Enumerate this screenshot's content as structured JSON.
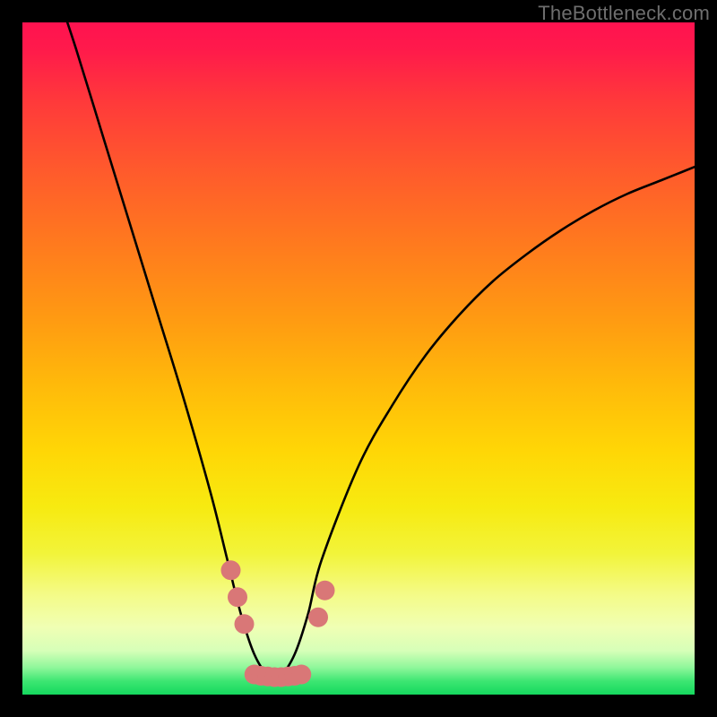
{
  "watermark": "TheBottleneck.com",
  "chart_data": {
    "type": "line",
    "title": "",
    "xlabel": "",
    "ylabel": "",
    "xlim": [
      0,
      1
    ],
    "ylim": [
      0,
      1
    ],
    "series": [
      {
        "name": "curve",
        "x": [
          0.05,
          0.08,
          0.12,
          0.16,
          0.2,
          0.24,
          0.28,
          0.305,
          0.325,
          0.345,
          0.365,
          0.385,
          0.405,
          0.425,
          0.445,
          0.5,
          0.55,
          0.6,
          0.65,
          0.7,
          0.75,
          0.8,
          0.85,
          0.9,
          0.95,
          1.0
        ],
        "y": [
          1.05,
          0.96,
          0.83,
          0.7,
          0.57,
          0.44,
          0.3,
          0.2,
          0.12,
          0.06,
          0.03,
          0.03,
          0.06,
          0.12,
          0.2,
          0.34,
          0.43,
          0.505,
          0.565,
          0.615,
          0.655,
          0.69,
          0.72,
          0.745,
          0.765,
          0.785
        ]
      }
    ],
    "markers": [
      {
        "x": 0.31,
        "y": 0.185
      },
      {
        "x": 0.32,
        "y": 0.145
      },
      {
        "x": 0.33,
        "y": 0.105
      },
      {
        "x": 0.345,
        "y": 0.03
      },
      {
        "x": 0.355,
        "y": 0.028
      },
      {
        "x": 0.365,
        "y": 0.027
      },
      {
        "x": 0.375,
        "y": 0.026
      },
      {
        "x": 0.385,
        "y": 0.026
      },
      {
        "x": 0.395,
        "y": 0.027
      },
      {
        "x": 0.405,
        "y": 0.028
      },
      {
        "x": 0.415,
        "y": 0.03
      },
      {
        "x": 0.44,
        "y": 0.115
      },
      {
        "x": 0.45,
        "y": 0.155
      }
    ],
    "gradient_stops": [
      {
        "offset": 0.0,
        "color": "#ff1250"
      },
      {
        "offset": 0.04,
        "color": "#ff1a4b"
      },
      {
        "offset": 0.12,
        "color": "#ff3a3a"
      },
      {
        "offset": 0.22,
        "color": "#ff5a2c"
      },
      {
        "offset": 0.33,
        "color": "#ff7a1e"
      },
      {
        "offset": 0.44,
        "color": "#ff9a12"
      },
      {
        "offset": 0.54,
        "color": "#ffba0a"
      },
      {
        "offset": 0.64,
        "color": "#ffd706"
      },
      {
        "offset": 0.72,
        "color": "#f7ea10"
      },
      {
        "offset": 0.79,
        "color": "#f2f43a"
      },
      {
        "offset": 0.85,
        "color": "#f4fb86"
      },
      {
        "offset": 0.9,
        "color": "#f0ffb4"
      },
      {
        "offset": 0.935,
        "color": "#d6ffb8"
      },
      {
        "offset": 0.96,
        "color": "#8ef79a"
      },
      {
        "offset": 0.98,
        "color": "#3de672"
      },
      {
        "offset": 1.0,
        "color": "#15d85e"
      }
    ],
    "marker_color": "#d97777",
    "curve_color": "#000000"
  }
}
